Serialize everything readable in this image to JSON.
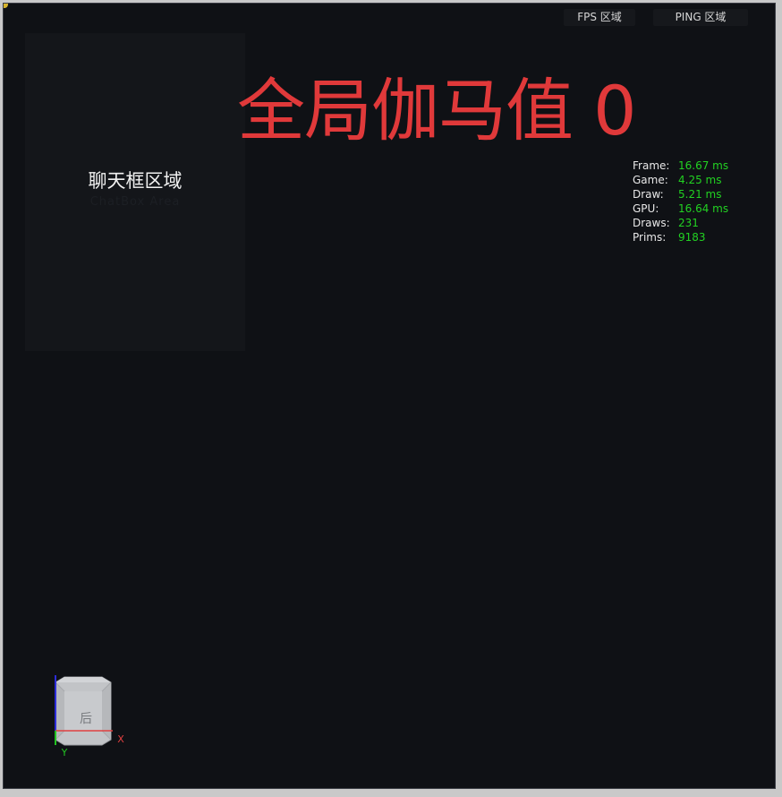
{
  "top_bar": {
    "fps_label": "FPS 区域",
    "ping_label": "PING 区域"
  },
  "chat_panel": {
    "title": "聊天框区域",
    "subtitle": "ChatBox Area"
  },
  "main_title": "全局伽马值 0",
  "stats": [
    {
      "label": "Frame:",
      "value": "16.67 ms"
    },
    {
      "label": "Game:",
      "value": "4.25 ms"
    },
    {
      "label": "Draw:",
      "value": "5.21 ms"
    },
    {
      "label": "GPU:",
      "value": "16.64 ms"
    },
    {
      "label": "Draws:",
      "value": "231"
    },
    {
      "label": "Prims:",
      "value": "9183"
    }
  ],
  "view_gizmo": {
    "face_label": "后",
    "x_axis_label": "X",
    "y_axis_label": "Y"
  },
  "colors": {
    "background": "#0f1115",
    "title_red": "#e0393a",
    "stat_green": "#22d122"
  }
}
